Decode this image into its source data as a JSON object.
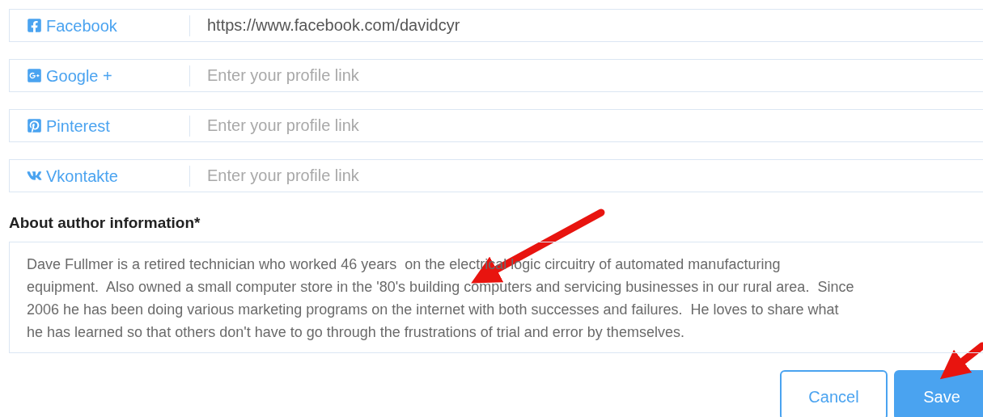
{
  "social_links": [
    {
      "kind": "facebook",
      "label": "Facebook",
      "value": "https://www.facebook.com/davidcyr"
    },
    {
      "kind": "google",
      "label": "Google +",
      "placeholder": "Enter your profile link"
    },
    {
      "kind": "pinterest",
      "label": "Pinterest",
      "placeholder": "Enter your profile link"
    },
    {
      "kind": "vk",
      "label": "Vkontakte",
      "placeholder": "Enter your profile link"
    }
  ],
  "about": {
    "label": "About author information*",
    "lines": [
      "Dave Fullmer is a retired technician who worked 46 years  on the electrical logic circuitry of automated manufacturing",
      "equipment.  Also owned a small computer store in the '80's building computers and servicing businesses in our rural area.  Since",
      "2006 he has been doing various marketing programs on the internet with both successes and failures.  He loves to share what",
      "he has learned so that others don't have to go through the frustrations of trial and error by themselves."
    ]
  },
  "buttons": [
    {
      "kind": "secondary",
      "label": "Cancel"
    },
    {
      "kind": "primary",
      "label": "Save"
    }
  ]
}
